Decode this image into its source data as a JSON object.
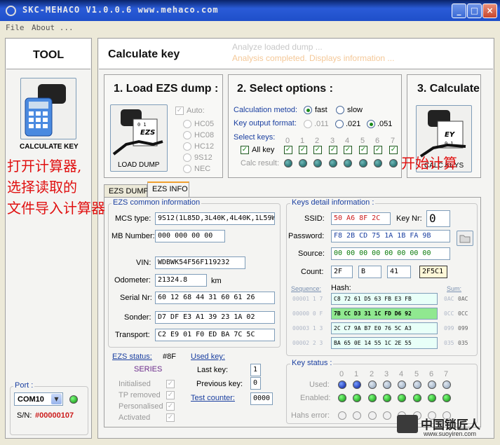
{
  "window": {
    "title": "SKC-MEHACO  V1.0.0.6  www.mehaco.com"
  },
  "menu": {
    "file": "File",
    "about": "About ..."
  },
  "tool": {
    "header": "TOOL",
    "calc_label": "CALCULATE KEY"
  },
  "port": {
    "label": "Port :",
    "value": "COM10",
    "sn_label": "S/N:",
    "sn_value": "#00000107"
  },
  "main": {
    "title": "Calculate key",
    "status1": "Analyze loaded dump ...",
    "status2": "Analysis completed. Displays information ..."
  },
  "step1": {
    "title": "1. Load EZS dump :",
    "btn_label": "LOAD DUMP",
    "auto": "Auto:",
    "opts": [
      "HC05",
      "HC08",
      "HC12",
      "9S12",
      "NEC"
    ]
  },
  "step2": {
    "title": "2. Select options :",
    "calc_method": "Calculation metod:",
    "fast": "fast",
    "slow": "slow",
    "key_format": "Key output format:",
    "f1": ".011",
    "f2": ".021",
    "f3": ".051",
    "select_keys": "Select keys:",
    "all_key": "All key",
    "calc_result": "Calc result:",
    "key_nums": [
      "0",
      "1",
      "2",
      "3",
      "4",
      "5",
      "6",
      "7"
    ]
  },
  "step3": {
    "title": "3. Calculate",
    "btn_label": "CALC KEYS"
  },
  "tabs": {
    "dump": "EZS DUMP",
    "info": "EZS INFO"
  },
  "common": {
    "group": "EZS common information",
    "mcs_label": "MCS type:",
    "mcs": "9S12(1L85D,3L40K,4L40K,1L59W,",
    "mb_label": "MB Number:",
    "mb": "000 000 00 00",
    "vin_label": "VIN:",
    "vin": "WDBWK54F56F119232",
    "odo_label": "Odometer:",
    "odo": "21324.8",
    "odo_unit": "km",
    "serial_label": "Serial Nr:",
    "serial": "60 12 68 44 31 60 61 26",
    "sonder_label": "Sonder:",
    "sonder": "D7 DF E3 A1 39 23 1A 02",
    "transport_label": "Transport:",
    "transport": "C2 E9 01 F0 ED BA 7C 5C"
  },
  "ezs_status": {
    "label": "EZS status:",
    "code": "#8F",
    "series": "SERIES",
    "items": [
      "Initialised",
      "TP removed",
      "Personalised",
      "Activated"
    ]
  },
  "used_key": {
    "label": "Used key:",
    "last_label": "Last key:",
    "last": "1",
    "prev_label": "Previous key:",
    "prev": "0",
    "test_label": "Test counter:",
    "test": "0000"
  },
  "keys_detail": {
    "group": "Keys detail information :",
    "ssid_label": "SSID:",
    "ssid": "50 A6 8F 2C",
    "keynr_label": "Key Nr:",
    "keynr": "0",
    "pwd_label": "Password:",
    "pwd": "F8 2B CD 75 1A 1B FA 9B",
    "src_label": "Source:",
    "src": "00 00 00 00 00 00 00 00",
    "count_label": "Count:",
    "c1": "2F",
    "c2": "B",
    "c3": "41",
    "c4": "2F5C1",
    "seq_label": "Sequence:",
    "hash_label": "Hash:",
    "sum_label": "Sum:",
    "rows": [
      {
        "seq": "00001 1 7",
        "hash": "C8 72 61 D5 63 FB E3 FB",
        "s1": "0AC",
        "s2": "0AC",
        "hl": false
      },
      {
        "seq": "00000 0 F",
        "hash": "7B CC D3 31 1C FD D6 92",
        "s1": "0CC",
        "s2": "0CC",
        "hl": true
      },
      {
        "seq": "00003 1 3",
        "hash": "2C C7 9A B7 E0 76 5C A3",
        "s1": "099",
        "s2": "099",
        "hl": false
      },
      {
        "seq": "00002 2 3",
        "hash": "BA 65 0E 14 55 1C 2E 55",
        "s1": "035",
        "s2": "035",
        "hl": false
      }
    ]
  },
  "key_status": {
    "group": "Key status :",
    "used": "Used:",
    "enabled": "Enabled:",
    "hash_err": "Hahs error:",
    "nums": [
      "0",
      "1",
      "2",
      "3",
      "4",
      "5",
      "6",
      "7"
    ]
  },
  "annotations": {
    "left": [
      "打开计算器,",
      "选择读取的",
      "文件导入计算器"
    ],
    "right": "开始计算"
  },
  "watermark": {
    "name": "中国锁匠人",
    "url": "www.suoyiren.com"
  }
}
